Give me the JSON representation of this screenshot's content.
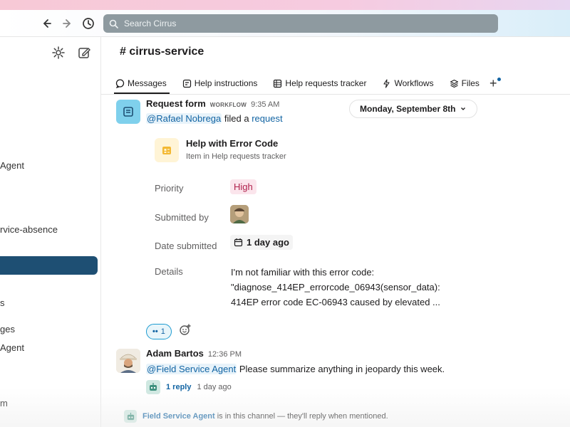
{
  "search": {
    "placeholder": "Search Cirrus"
  },
  "sidebar": {
    "items": [
      {
        "label": "Agent"
      },
      {
        "label": "rvice-absence"
      },
      {
        "label": "s"
      },
      {
        "label": "ges"
      },
      {
        "label": "Agent"
      },
      {
        "label": "m"
      }
    ]
  },
  "channel": {
    "title": "# cirrus-service",
    "tabs": [
      {
        "label": "Messages",
        "icon": "chat-bubble-icon"
      },
      {
        "label": "Help instructions",
        "icon": "canvas-icon"
      },
      {
        "label": "Help requests tracker",
        "icon": "list-icon"
      },
      {
        "label": "Workflows",
        "icon": "workflow-icon"
      },
      {
        "label": "Files",
        "icon": "files-icon"
      }
    ]
  },
  "date_divider": "Monday, September 8th",
  "workflow_message": {
    "name": "Request form",
    "badge": "WORKFLOW",
    "time": "9:35 AM",
    "mention": "@Rafael Nobrega",
    "text": "filed a",
    "link": "request"
  },
  "card": {
    "title": "Help with Error Code",
    "subtitle": "Item in Help requests tracker",
    "priority_label": "Priority",
    "priority_value": "High",
    "submitted_by_label": "Submitted by",
    "date_label": "Date submitted",
    "date_value": "1 day ago",
    "details_label": "Details",
    "details_line1": "I'm not familiar with this error code:",
    "details_line2": "\"diagnose_414EP_errorcode_06943(sensor_data):",
    "details_line3": "414EP error code EC-06943 caused by elevated ..."
  },
  "reaction": {
    "emoji": "••",
    "count": "1"
  },
  "adam_message": {
    "name": "Adam Bartos",
    "time": "12:36 PM",
    "mention": "@Field Service Agent",
    "text": "Please summarize anything in jeopardy this week.",
    "replies": "1 reply",
    "reply_time": "1 day ago"
  },
  "footer": {
    "agent": "Field Service Agent",
    "text": "is in this channel — they'll reply when mentioned."
  },
  "colors": {
    "accent": "#1264a3",
    "sidebar_active": "#1e4f73",
    "priority_high": "#b0224d",
    "search_bg": "#8e9aa0"
  }
}
